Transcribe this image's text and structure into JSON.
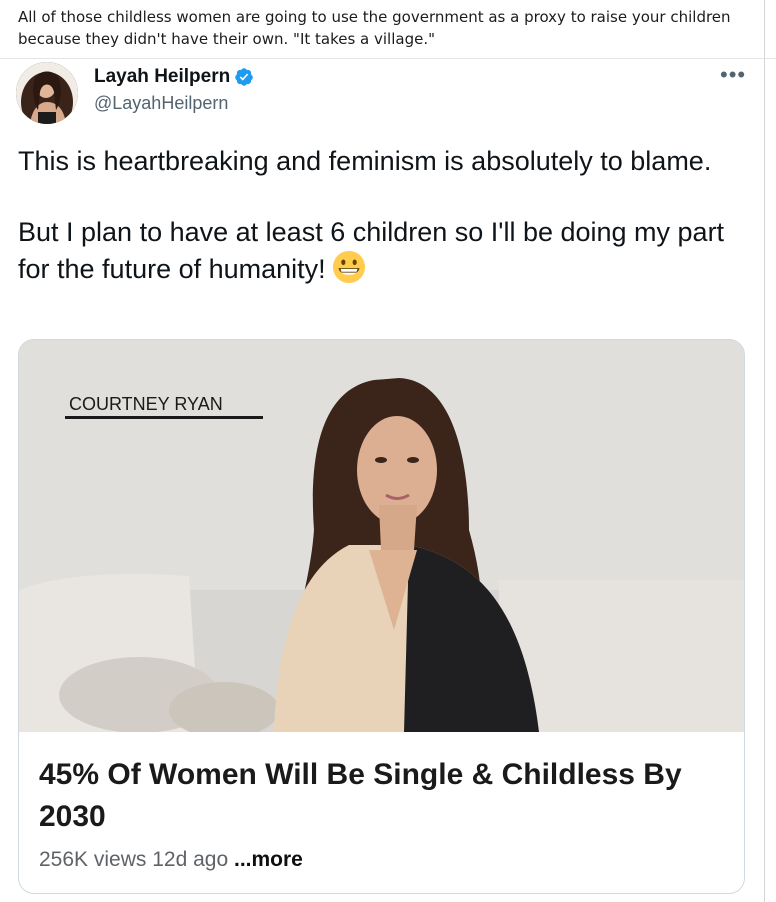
{
  "caption": {
    "text": "All of those childless women are going to use the government as a proxy to raise your children because they didn't have their own. \"It takes a village.\""
  },
  "tweet": {
    "author_name": "Layah Heilpern",
    "handle": "@LayahHeilpern",
    "verified": true,
    "more_icon": "more-dots-icon",
    "paragraphs": [
      "This is heartbreaking and feminism is absolutely to blame.",
      "But I plan to have at least 6 children so I'll be doing my part for the future of humanity!"
    ],
    "emoji": "grinning-face-icon"
  },
  "embed": {
    "thumbnail_label": "COURTNEY RYAN",
    "title": "45% Of Women Will Be Single & Childless By 2030",
    "views": "256K views",
    "age": "12d ago",
    "more_label": "...more"
  },
  "colors": {
    "verified_blue": "#1d9bf0",
    "handle_gray": "#536471",
    "text_dark": "#0f1419"
  }
}
